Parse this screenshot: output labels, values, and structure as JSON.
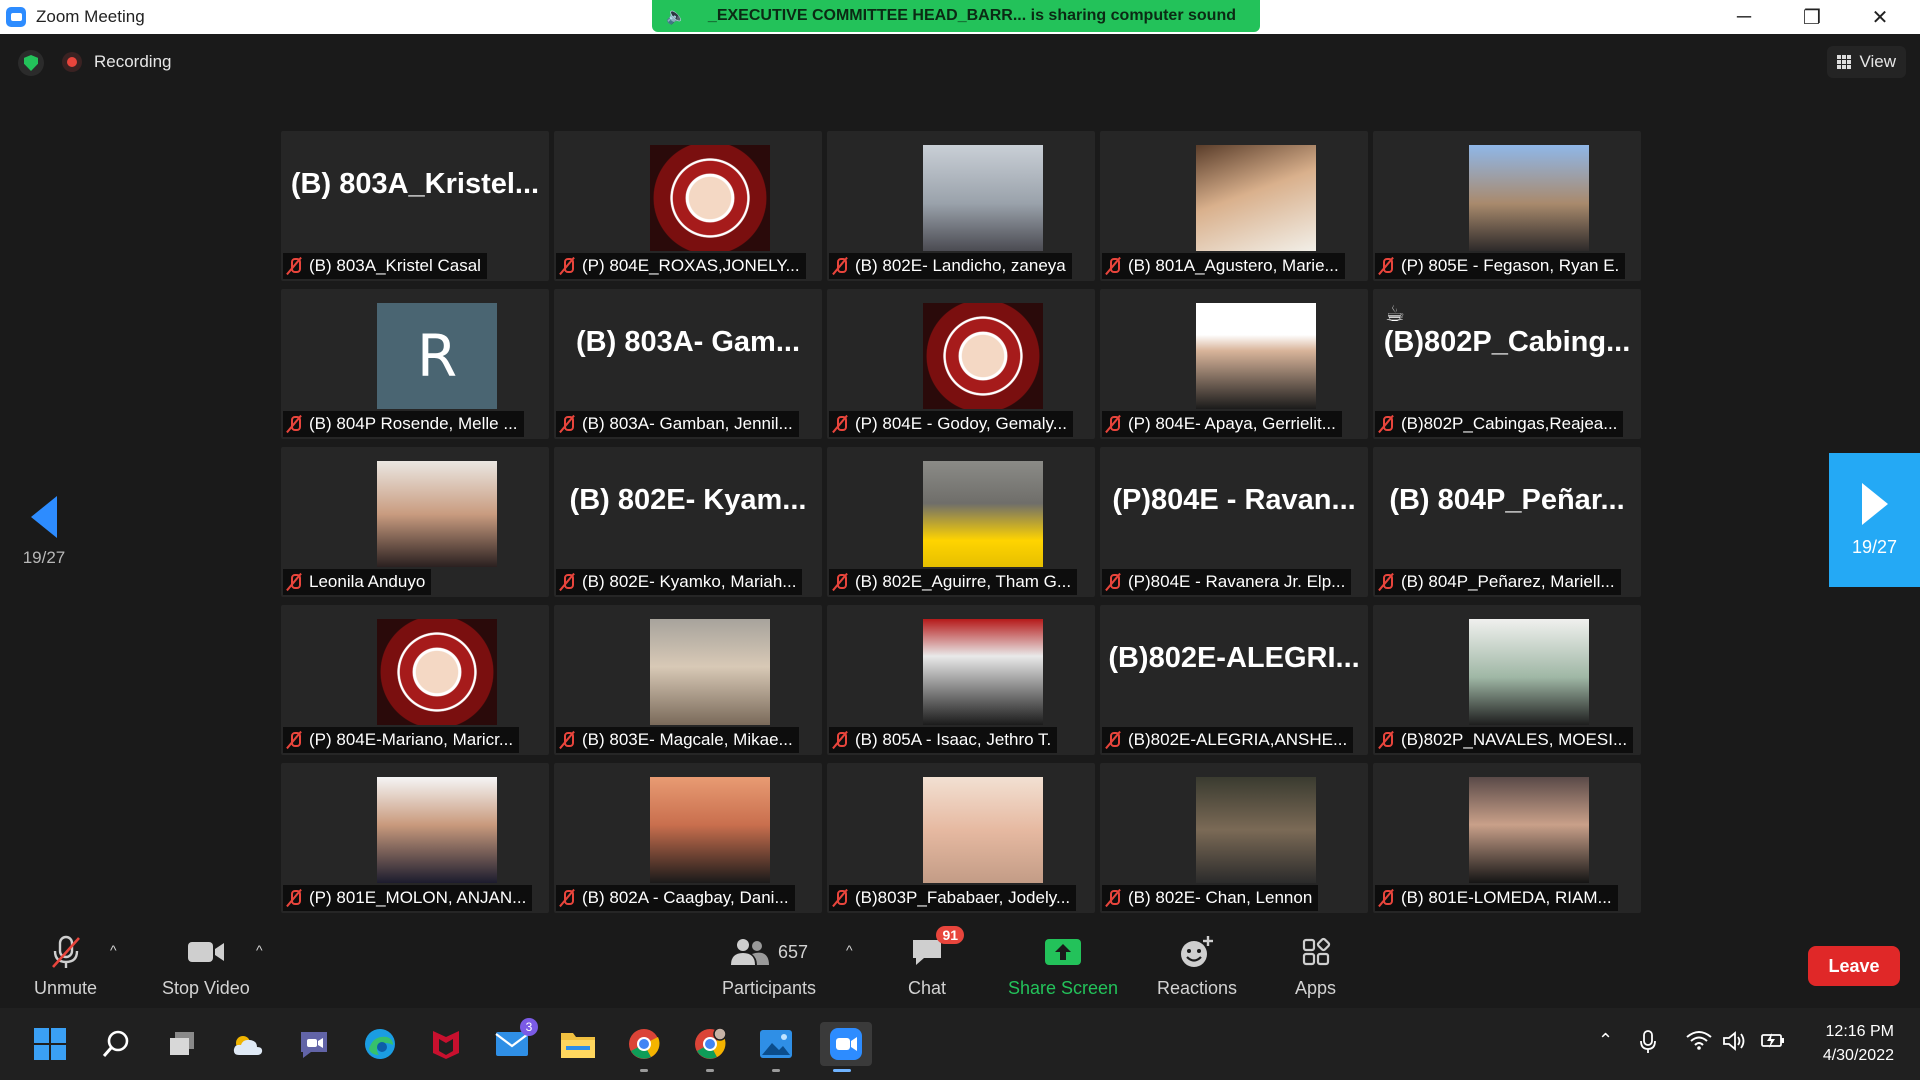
{
  "window": {
    "title": "Zoom Meeting"
  },
  "share_banner": {
    "text": "_EXECUTIVE COMMITTEE HEAD_BARR... is sharing computer sound"
  },
  "status": {
    "recording": "Recording",
    "view": "View"
  },
  "pagination": {
    "left": "19/27",
    "right": "19/27"
  },
  "tiles": [
    {
      "big": "(B)  803A_Kristel...",
      "caption": "(B) 803A_Kristel Casal"
    },
    {
      "photo": "badge",
      "caption": "(P) 804E_ROXAS,JONELY..."
    },
    {
      "photo": "1",
      "caption": "(B) 802E- Landicho, zaneya"
    },
    {
      "photo": "2",
      "caption": "(B) 801A_Agustero, Marie..."
    },
    {
      "photo": "3",
      "caption": "(P) 805E - Fegason, Ryan E."
    },
    {
      "photo": "r",
      "initial": "R",
      "caption": "(B) 804P Rosende, Melle ..."
    },
    {
      "big": "(B)  803A-  Gam...",
      "caption": "(B) 803A- Gamban, Jennil..."
    },
    {
      "photo": "badge",
      "caption": "(P) 804E - Godoy, Gemaly..."
    },
    {
      "photo": "4",
      "caption": "(P) 804E- Apaya, Gerrielit..."
    },
    {
      "big": "(B)802P_Cabing...",
      "coffee": "☕",
      "caption": "(B)802P_Cabingas,Reajea..."
    },
    {
      "photo": "5",
      "caption": "Leonila Anduyo"
    },
    {
      "big": "(B)  802E-  Kyam...",
      "caption": "(B) 802E- Kyamko, Mariah..."
    },
    {
      "photo": "6",
      "caption": "(B) 802E_Aguirre, Tham G..."
    },
    {
      "big": "(P)804E  -  Ravan...",
      "caption": "(P)804E - Ravanera Jr. Elp..."
    },
    {
      "big": "(B)  804P_Peñar...",
      "caption": "(B) 804P_Peñarez, Mariell..."
    },
    {
      "photo": "badge",
      "caption": "(P) 804E-Mariano, Maricr..."
    },
    {
      "photo": "7",
      "caption": "(B) 803E- Magcale, Mikae..."
    },
    {
      "photo": "8",
      "caption": "(B) 805A - Isaac, Jethro T."
    },
    {
      "big": "(B)802E-ALEGRI...",
      "caption": "(B)802E-ALEGRIA,ANSHE..."
    },
    {
      "photo": "9",
      "caption": "(B)802P_NAVALES, MOESI..."
    },
    {
      "photo": "10",
      "caption": "(P) 801E_MOLON, ANJAN..."
    },
    {
      "photo": "11",
      "caption": "(B) 802A - Caagbay, Dani..."
    },
    {
      "photo": "12",
      "caption": "(B)803P_Fababaer, Jodely..."
    },
    {
      "photo": "13",
      "caption": "(B) 802E- Chan, Lennon"
    },
    {
      "photo": "14",
      "caption": "(B) 801E-LOMEDA, RIAM..."
    }
  ],
  "toolbar": {
    "unmute": "Unmute",
    "stop_video": "Stop Video",
    "participants": "Participants",
    "participants_count": "657",
    "chat": "Chat",
    "chat_badge": "91",
    "share_screen": "Share Screen",
    "reactions": "Reactions",
    "apps": "Apps",
    "leave": "Leave"
  },
  "taskbar": {
    "mail_badge": "3",
    "time": "12:16 PM",
    "date": "4/30/2022"
  },
  "colors": {
    "accent": "#2d8cff",
    "share_green": "#23c25a",
    "leave_red": "#e02828",
    "muted_red": "#e8453c"
  }
}
